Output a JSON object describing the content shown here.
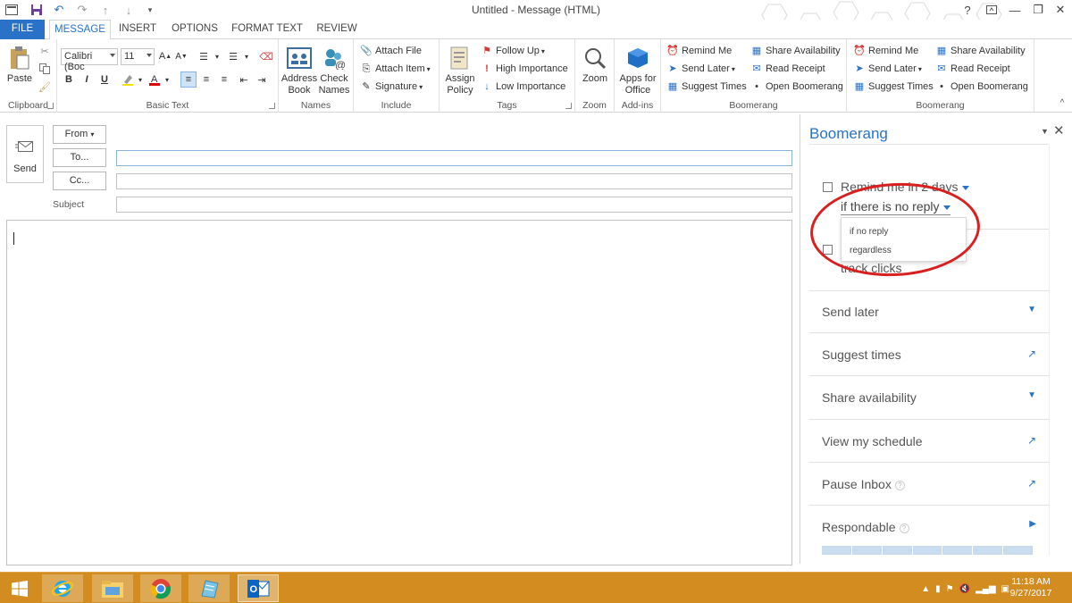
{
  "window": {
    "title": "Untitled - Message (HTML)",
    "help_label": "?",
    "controls": {
      "minimize": "—",
      "restore": "❐",
      "close": "✕"
    }
  },
  "quick_access": [
    "save-icon",
    "undo-icon",
    "redo-icon",
    "up-arrow-icon",
    "down-arrow-icon",
    "customize-icon"
  ],
  "tabs": {
    "file": "FILE",
    "message": "MESSAGE",
    "insert": "INSERT",
    "options": "OPTIONS",
    "format_text": "FORMAT TEXT",
    "review": "REVIEW"
  },
  "ribbon": {
    "clipboard": {
      "label": "Clipboard",
      "paste": "Paste"
    },
    "basic_text": {
      "label": "Basic Text",
      "font": "Calibri (Boc",
      "size": "11",
      "bold": "B",
      "italic": "I",
      "underline": "U"
    },
    "names": {
      "label": "Names",
      "address_book_1": "Address",
      "address_book_2": "Book",
      "check_names_1": "Check",
      "check_names_2": "Names"
    },
    "include": {
      "label": "Include",
      "attach_file": "Attach File",
      "attach_item": "Attach Item",
      "signature": "Signature"
    },
    "tags": {
      "label": "Tags",
      "assign_policy_1": "Assign",
      "assign_policy_2": "Policy",
      "follow_up": "Follow Up",
      "high_importance": "High Importance",
      "low_importance": "Low Importance"
    },
    "zoom": {
      "label": "Zoom",
      "zoom": "Zoom"
    },
    "addins": {
      "label": "Add-ins",
      "apps_1": "Apps for",
      "apps_2": "Office"
    },
    "boomerang1": {
      "label": "Boomerang",
      "remind_me": "Remind Me",
      "send_later": "Send Later",
      "suggest_times": "Suggest Times",
      "share_availability": "Share Availability",
      "read_receipt": "Read Receipt",
      "open_boomerang": "Open Boomerang"
    },
    "boomerang2": {
      "label": "Boomerang",
      "remind_me": "Remind Me",
      "send_later": "Send Later",
      "suggest_times": "Suggest Times",
      "share_availability": "Share Availability",
      "read_receipt": "Read Receipt",
      "open_boomerang": "Open Boomerang"
    }
  },
  "compose": {
    "send": "Send",
    "from": "From",
    "to": "To...",
    "cc": "Cc...",
    "subject_label": "Subject",
    "to_value": "",
    "cc_value": "",
    "subject_value": "",
    "body": ""
  },
  "pane": {
    "title": "Boomerang",
    "remind_label": "Remind me in 2 days",
    "condition": "if there is no reply",
    "dropdown_options": [
      "if no reply",
      "regardless"
    ],
    "track_clicks": "track clicks",
    "rows": [
      {
        "label": "Send later",
        "icon": "chevron-down-icon"
      },
      {
        "label": "Suggest times",
        "icon": "external-arrow-icon"
      },
      {
        "label": "Share availability",
        "icon": "chevron-down-icon"
      },
      {
        "label": "View my schedule",
        "icon": "external-arrow-icon"
      },
      {
        "label": "Pause Inbox",
        "icon": "external-arrow-icon"
      },
      {
        "label": "Respondable",
        "icon": "chevron-right-icon"
      }
    ],
    "highlight_color": "#d92020",
    "accent_color": "#2a72c8"
  },
  "taskbar": {
    "apps": [
      "start-icon",
      "internet-explorer-icon",
      "file-explorer-icon",
      "chrome-icon",
      "notepad-icon",
      "outlook-icon"
    ],
    "time": "11:18 AM",
    "date": "9/27/2017",
    "color": "#d28c1f"
  }
}
